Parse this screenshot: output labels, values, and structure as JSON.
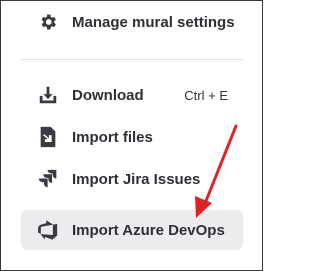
{
  "menu": {
    "items": [
      {
        "id": "manage-mural-settings",
        "label": "Manage mural settings",
        "icon": "gear-icon"
      },
      {
        "id": "download",
        "label": "Download",
        "icon": "download-icon",
        "shortcut": "Ctrl + E"
      },
      {
        "id": "import-files",
        "label": "Import files",
        "icon": "import-file-icon"
      },
      {
        "id": "import-jira-issues",
        "label": "Import Jira Issues",
        "icon": "jira-icon"
      },
      {
        "id": "import-azure-devops",
        "label": "Import Azure DevOps",
        "icon": "azure-devops-icon",
        "highlighted": true
      }
    ]
  },
  "annotation": {
    "arrow_color": "#e32222",
    "points_to": "import-azure-devops"
  },
  "colors": {
    "text": "#2f2f36",
    "icon": "#3a3a42",
    "highlight": "#ececef",
    "divider": "#e3e3e6",
    "border": "#3a3a3a"
  }
}
